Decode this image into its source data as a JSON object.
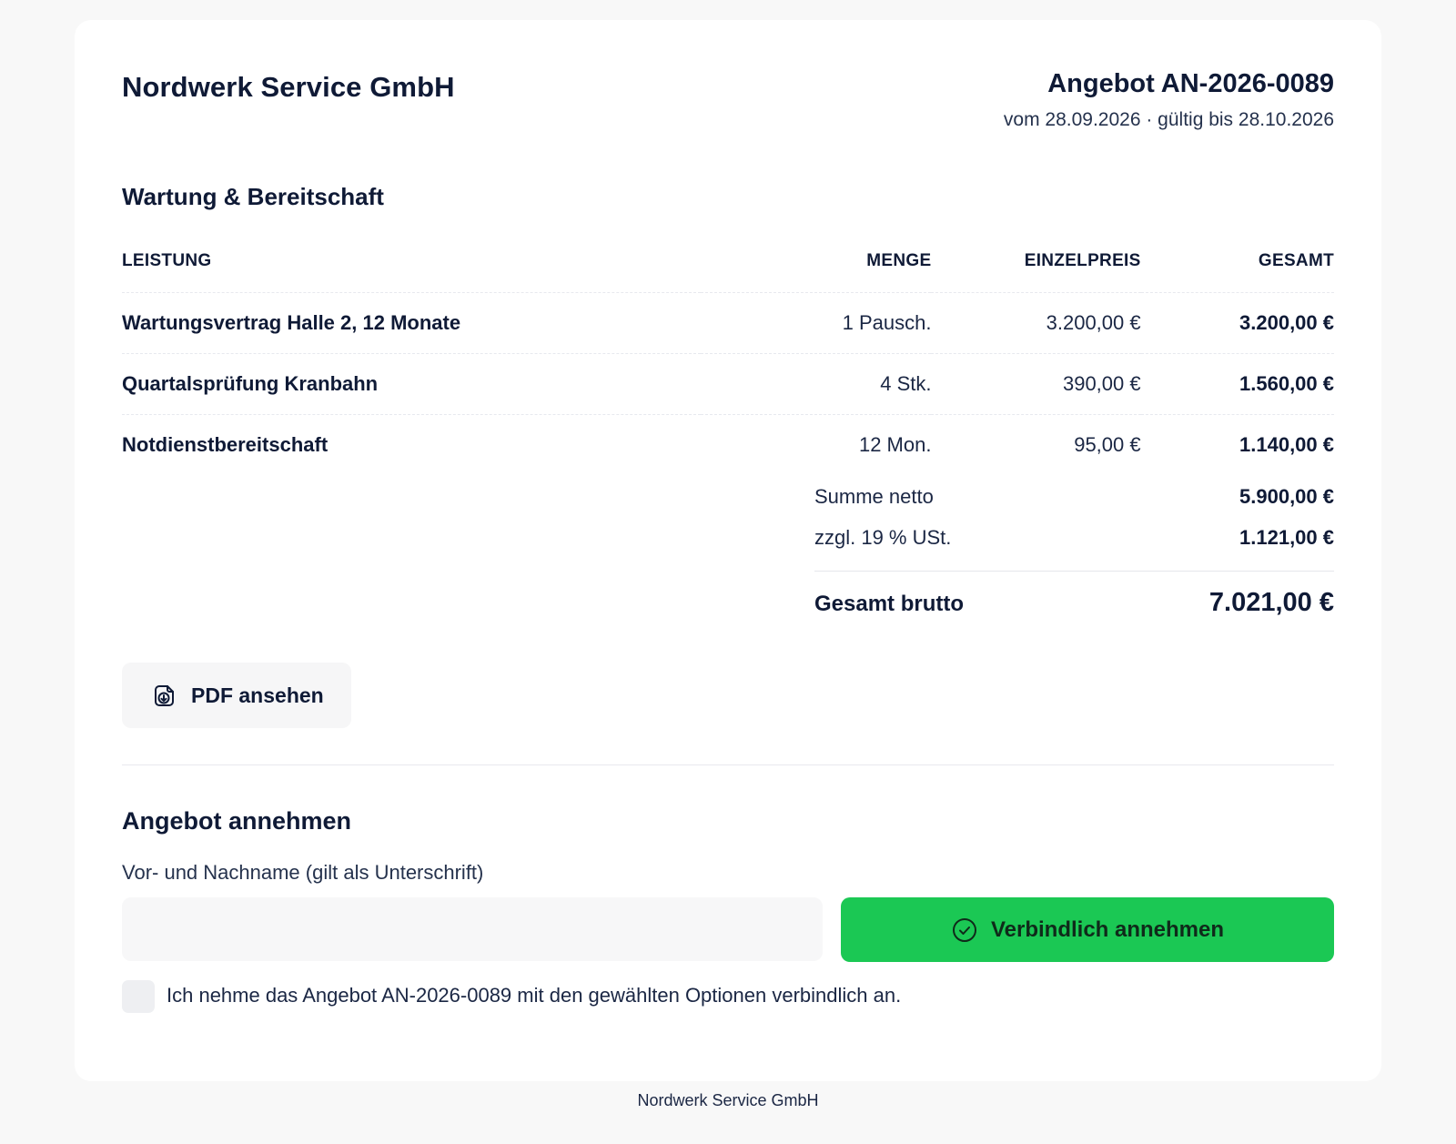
{
  "header": {
    "company_name": "Nordwerk Service GmbH",
    "offer_title": "Angebot AN-2026-0089",
    "offer_meta": "vom 28.09.2026 · gültig bis 28.10.2026"
  },
  "section": {
    "title": "Wartung & Bereitschaft"
  },
  "table": {
    "columns": [
      "LEISTUNG",
      "MENGE",
      "EINZELPREIS",
      "GESAMT"
    ],
    "rows": [
      {
        "name": "Wartungsvertrag Halle 2, 12 Monate",
        "qty": "1 Pausch.",
        "unit_price": "3.200,00 €",
        "total": "3.200,00 €"
      },
      {
        "name": "Quartalsprüfung Kranbahn",
        "qty": "4 Stk.",
        "unit_price": "390,00 €",
        "total": "1.560,00 €"
      },
      {
        "name": "Notdienstbereitschaft",
        "qty": "12 Mon.",
        "unit_price": "95,00 €",
        "total": "1.140,00 €"
      }
    ]
  },
  "totals": {
    "net_label": "Summe netto",
    "net_value": "5.900,00 €",
    "vat_label": "zzgl. 19 % USt.",
    "vat_value": "1.121,00 €",
    "gross_label": "Gesamt brutto",
    "gross_value": "7.021,00 €"
  },
  "actions": {
    "pdf_label": "PDF ansehen",
    "pdf_icon": "document-download-icon"
  },
  "accept": {
    "title": "Angebot annehmen",
    "name_label": "Vor- und Nachname (gilt als Unterschrift)",
    "name_value": "",
    "name_placeholder": "",
    "button_label": "Verbindlich annehmen",
    "button_icon": "check-circle-icon",
    "checkbox_label": "Ich nehme das Angebot AN-2026-0089 mit den gewählten Optionen verbindlich an.",
    "checkbox_checked": false
  },
  "footer": {
    "text": "Nordwerk Service GmbH"
  },
  "colors": {
    "accent_green": "#1bc854",
    "text_primary": "#0f1a36",
    "page_bg": "#f8f8f8"
  }
}
